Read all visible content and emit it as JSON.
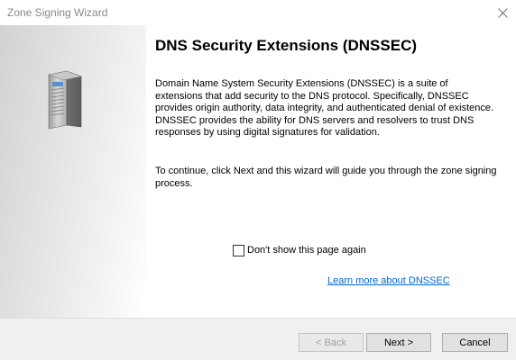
{
  "window": {
    "title": "Zone Signing Wizard",
    "close_icon": "close-icon"
  },
  "sidebar": {
    "icon": "server-tower-icon"
  },
  "content": {
    "heading": "DNS Security Extensions (DNSSEC)",
    "paragraph1": "Domain Name System Security Extensions (DNSSEC) is a suite of extensions that add security to the DNS protocol. Specifically, DNSSEC provides origin authority, data integrity, and authenticated denial of existence. DNSSEC provides the ability for DNS servers and resolvers to trust DNS responses by using digital signatures for validation.",
    "paragraph2": "To continue, click Next and this wizard will guide you through the zone signing process.",
    "checkbox_label": "Don't show this page again",
    "checkbox_checked": false,
    "learn_more_link": "Learn more about DNSSEC"
  },
  "footer": {
    "back_label": "< Back",
    "back_enabled": false,
    "next_label": "Next >",
    "cancel_label": "Cancel"
  },
  "colors": {
    "link": "#0066cc",
    "title_text": "#8a8a8a",
    "footer_bg": "#f0f0f0"
  }
}
